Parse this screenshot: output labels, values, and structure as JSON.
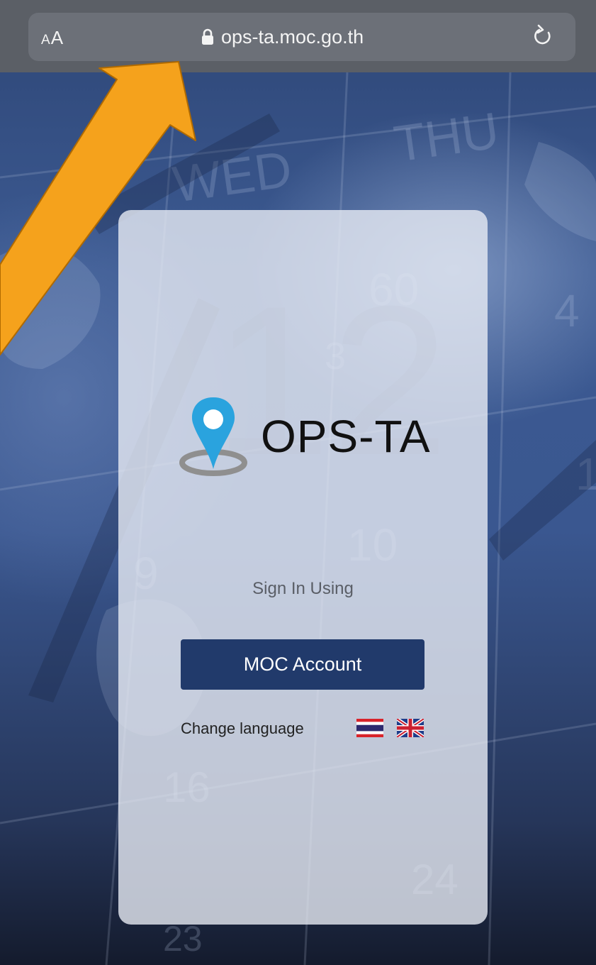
{
  "browser": {
    "text_size_label": "AA",
    "url": "ops-ta.moc.go.th",
    "lock_icon": "lock-icon",
    "reload_icon": "reload-icon"
  },
  "background": {
    "calendar_marks": [
      "WED",
      "THU",
      "60",
      "3",
      "4",
      "10",
      "9",
      "1",
      "16",
      "24",
      "23",
      "12"
    ]
  },
  "login": {
    "app_name": "OPS-TA",
    "logo_icon": "map-pin-icon",
    "sign_in_label": "Sign In Using",
    "moc_button_label": "MOC Account",
    "change_language_label": "Change language",
    "languages": [
      "thai-flag-icon",
      "uk-flag-icon"
    ]
  },
  "annotation": {
    "arrow_color": "#f5a21c",
    "arrow_outline": "#b06a00"
  },
  "colors": {
    "primary_button": "#213a6b",
    "browser_bar": "#5b5f66",
    "card": "#e7ebf4"
  }
}
